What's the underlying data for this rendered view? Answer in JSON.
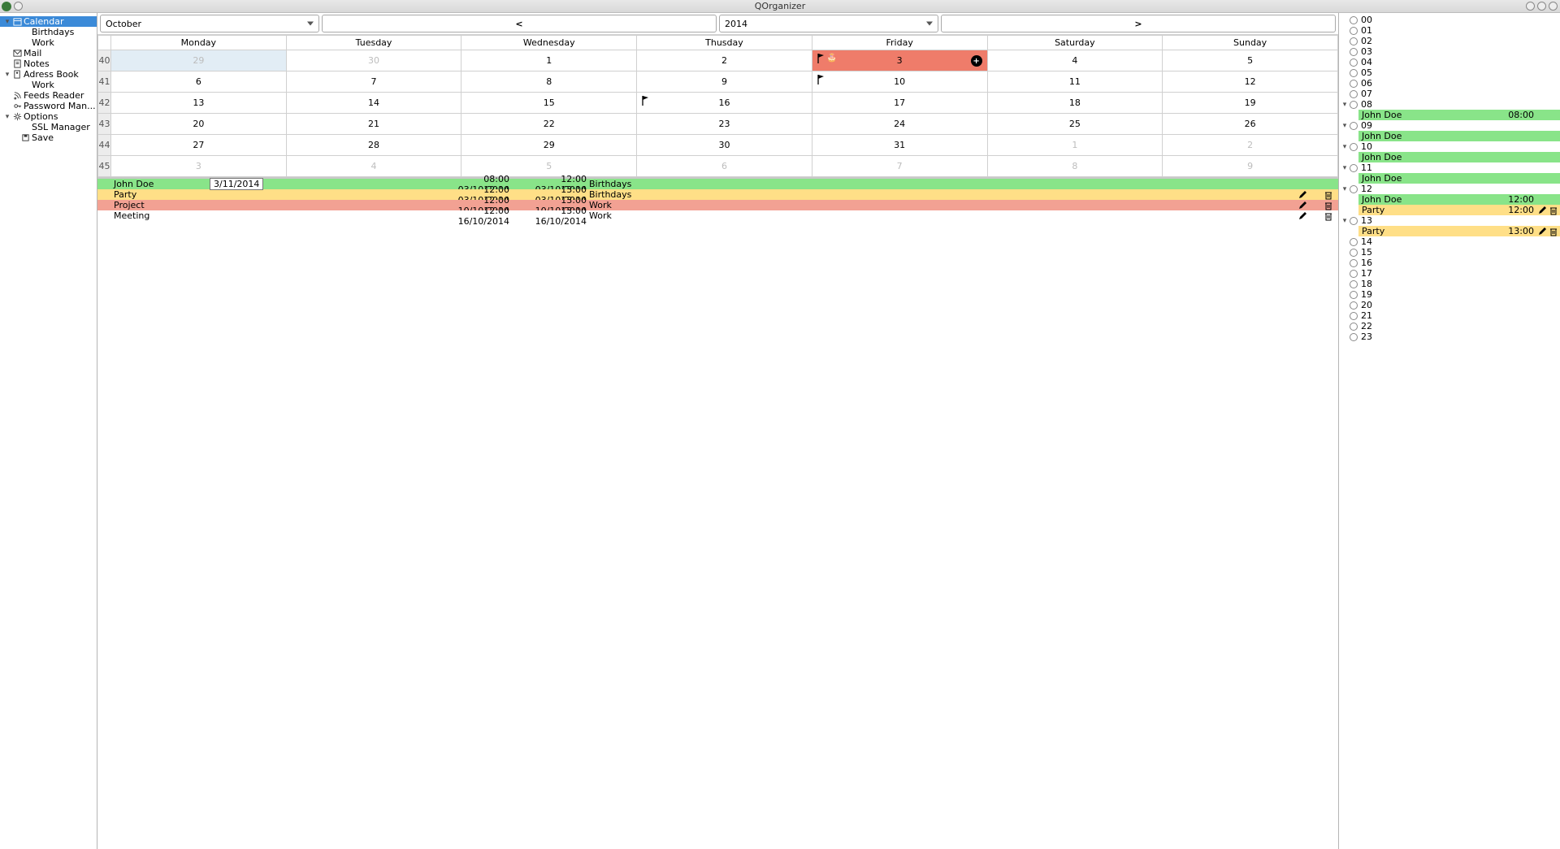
{
  "app": {
    "title": "QOrganizer"
  },
  "sidebar": {
    "items": [
      {
        "label": "Calendar",
        "icon": "calendar-icon",
        "expander": true,
        "indent": 0,
        "selected": true
      },
      {
        "label": "Birthdays",
        "icon": "",
        "expander": false,
        "indent": 1
      },
      {
        "label": "Work",
        "icon": "",
        "expander": false,
        "indent": 1
      },
      {
        "label": "Mail",
        "icon": "mail-icon",
        "expander": false,
        "indent": 0
      },
      {
        "label": "Notes",
        "icon": "notes-icon",
        "expander": false,
        "indent": 0
      },
      {
        "label": "Adress Book",
        "icon": "addressbook-icon",
        "expander": true,
        "indent": 0
      },
      {
        "label": "Work",
        "icon": "",
        "expander": false,
        "indent": 1
      },
      {
        "label": "Feeds Reader",
        "icon": "feed-icon",
        "expander": false,
        "indent": 0
      },
      {
        "label": "Password Man...",
        "icon": "key-icon",
        "expander": false,
        "indent": 0
      },
      {
        "label": "Options",
        "icon": "gear-icon",
        "expander": true,
        "indent": 0
      },
      {
        "label": "SSL Manager",
        "icon": "",
        "expander": false,
        "indent": 1
      },
      {
        "label": "Save",
        "icon": "save-icon",
        "expander": false,
        "indent": 1
      }
    ]
  },
  "toolbar": {
    "month": "October",
    "year": "2014",
    "prev": "<",
    "next": ">"
  },
  "calendar": {
    "days": [
      "Monday",
      "Tuesday",
      "Wednesday",
      "Thusday",
      "Friday",
      "Saturday",
      "Sunday"
    ],
    "weeks": [
      {
        "num": "40",
        "cells": [
          {
            "d": "29",
            "other": true,
            "selblue": true
          },
          {
            "d": "30",
            "other": true
          },
          {
            "d": "1"
          },
          {
            "d": "2"
          },
          {
            "d": "3",
            "today": true,
            "flag": true,
            "cake": true,
            "plus": true
          },
          {
            "d": "4"
          },
          {
            "d": "5"
          }
        ]
      },
      {
        "num": "41",
        "cells": [
          {
            "d": "6"
          },
          {
            "d": "7"
          },
          {
            "d": "8"
          },
          {
            "d": "9"
          },
          {
            "d": "10",
            "flag": true
          },
          {
            "d": "11"
          },
          {
            "d": "12"
          }
        ]
      },
      {
        "num": "42",
        "cells": [
          {
            "d": "13"
          },
          {
            "d": "14"
          },
          {
            "d": "15"
          },
          {
            "d": "16",
            "flag": true
          },
          {
            "d": "17"
          },
          {
            "d": "18"
          },
          {
            "d": "19"
          }
        ]
      },
      {
        "num": "43",
        "cells": [
          {
            "d": "20"
          },
          {
            "d": "21"
          },
          {
            "d": "22"
          },
          {
            "d": "23"
          },
          {
            "d": "24"
          },
          {
            "d": "25"
          },
          {
            "d": "26"
          }
        ]
      },
      {
        "num": "44",
        "cells": [
          {
            "d": "27"
          },
          {
            "d": "28"
          },
          {
            "d": "29"
          },
          {
            "d": "30"
          },
          {
            "d": "31"
          },
          {
            "d": "1",
            "other": true
          },
          {
            "d": "2",
            "other": true
          }
        ]
      },
      {
        "num": "45",
        "cells": [
          {
            "d": "3",
            "other": true
          },
          {
            "d": "4",
            "other": true
          },
          {
            "d": "5",
            "other": true
          },
          {
            "d": "6",
            "other": true
          },
          {
            "d": "7",
            "other": true
          },
          {
            "d": "8",
            "other": true
          },
          {
            "d": "9",
            "other": true
          }
        ]
      }
    ]
  },
  "day_detail": {
    "date_chip": "3/11/2014",
    "events": [
      {
        "title": "John Doe",
        "start": "08:00 03/10/2014",
        "end": "12:00 03/10/2014",
        "cat": "Birthdays",
        "color": "green",
        "actions": false
      },
      {
        "title": "Party",
        "start": "12:00 03/10/2014",
        "end": "13:00 03/10/2014",
        "cat": "Birthdays",
        "color": "orange",
        "actions": true
      },
      {
        "title": "Project",
        "start": "12:00 10/10/2014",
        "end": "13:00 10/10/2014",
        "cat": "Work",
        "color": "red",
        "actions": true
      },
      {
        "title": "Meeting",
        "start": "12:00 16/10/2014",
        "end": "13:00 16/10/2014",
        "cat": "Work",
        "color": "white",
        "actions": true
      }
    ]
  },
  "hours": {
    "rows": [
      {
        "h": "00"
      },
      {
        "h": "01"
      },
      {
        "h": "02"
      },
      {
        "h": "03"
      },
      {
        "h": "04"
      },
      {
        "h": "05"
      },
      {
        "h": "06"
      },
      {
        "h": "07"
      },
      {
        "h": "08",
        "exp": true,
        "events": [
          {
            "title": "John Doe",
            "t": "08:00",
            "color": "green",
            "acts": false
          }
        ]
      },
      {
        "h": "09",
        "exp": true,
        "events": [
          {
            "title": "John Doe",
            "t": "",
            "color": "green",
            "acts": false
          }
        ]
      },
      {
        "h": "10",
        "exp": true,
        "events": [
          {
            "title": "John Doe",
            "t": "",
            "color": "green",
            "acts": false
          }
        ]
      },
      {
        "h": "11",
        "exp": true,
        "events": [
          {
            "title": "John Doe",
            "t": "",
            "color": "green",
            "acts": false
          }
        ]
      },
      {
        "h": "12",
        "exp": true,
        "events": [
          {
            "title": "John Doe",
            "t": "12:00",
            "color": "green",
            "acts": false
          },
          {
            "title": "Party",
            "t": "12:00",
            "color": "orange",
            "acts": true
          }
        ]
      },
      {
        "h": "13",
        "exp": true,
        "events": [
          {
            "title": "Party",
            "t": "13:00",
            "color": "orange",
            "acts": true
          }
        ]
      },
      {
        "h": "14"
      },
      {
        "h": "15"
      },
      {
        "h": "16"
      },
      {
        "h": "17"
      },
      {
        "h": "18"
      },
      {
        "h": "19"
      },
      {
        "h": "20"
      },
      {
        "h": "21"
      },
      {
        "h": "22"
      },
      {
        "h": "23"
      }
    ]
  },
  "colors": {
    "green": "#89e489",
    "orange": "#ffdf87",
    "red": "#f2a193",
    "today": "#ef7c6a",
    "select": "#3b8ad8"
  }
}
